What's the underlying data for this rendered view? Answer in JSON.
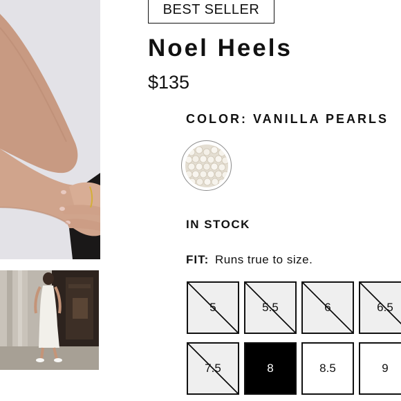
{
  "gallery": {
    "main_image_alt": "Model in black skirt with crossed arms",
    "thumb_image_alt": "Model in white dress wearing white heels"
  },
  "product": {
    "badge": "BEST SELLER",
    "name": "Noel Heels",
    "price": "$135"
  },
  "color": {
    "label": "COLOR:",
    "value": "VANILLA PEARLS",
    "swatch_name": "Vanilla Pearls swatch"
  },
  "stock_status": "IN STOCK",
  "fit": {
    "label": "FIT:",
    "text": "Runs true to size."
  },
  "sizes": [
    {
      "label": "5",
      "available": false,
      "selected": false
    },
    {
      "label": "5.5",
      "available": false,
      "selected": false
    },
    {
      "label": "6",
      "available": false,
      "selected": false
    },
    {
      "label": "6.5",
      "available": false,
      "selected": false
    },
    {
      "label": "7.5",
      "available": false,
      "selected": false
    },
    {
      "label": "8",
      "available": true,
      "selected": true
    },
    {
      "label": "8.5",
      "available": true,
      "selected": false
    },
    {
      "label": "9",
      "available": true,
      "selected": false
    }
  ],
  "colors": {
    "text": "#111111",
    "unavailable_bg": "#efefef",
    "selected_bg": "#000000"
  }
}
